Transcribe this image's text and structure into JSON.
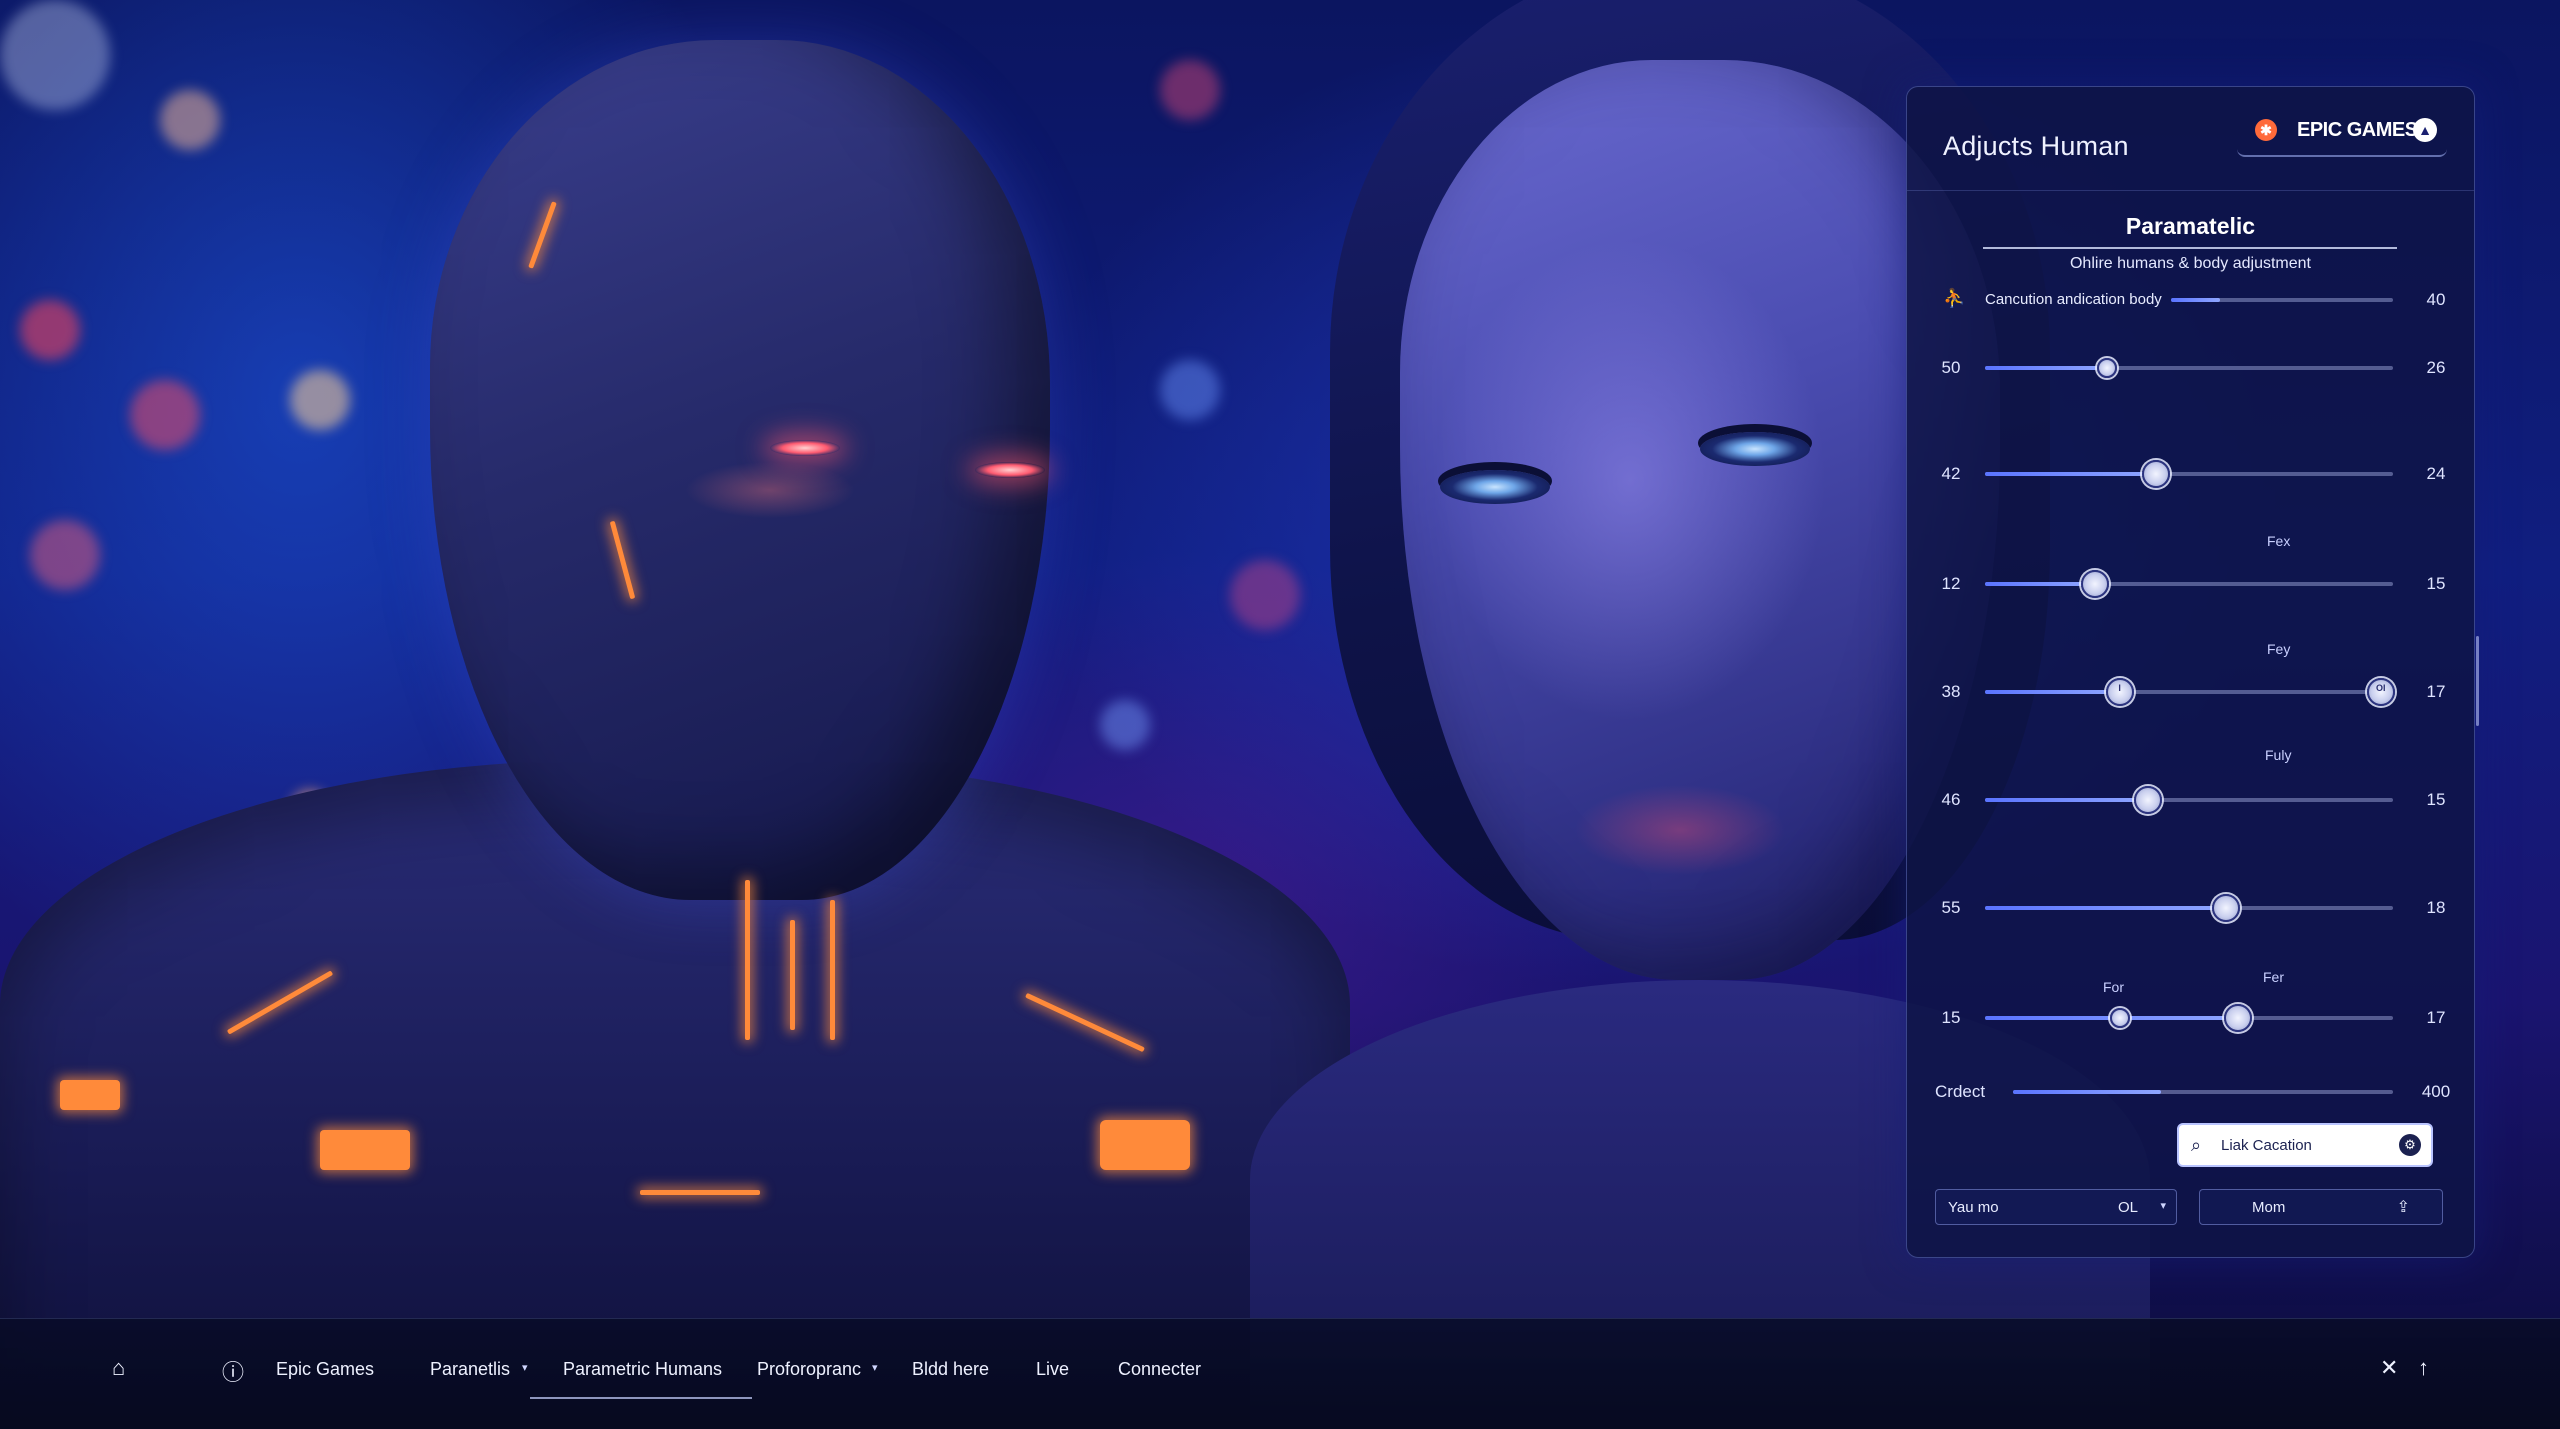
{
  "panel": {
    "title": "Adjucts Human",
    "brand": {
      "name": "EPIC GAMES",
      "mark_icon": "epic-logo-icon",
      "badge_icon": "user-badge-icon"
    },
    "section_title": "Paramatelic",
    "section_subtitle": "Ohlire humans & body adjustment",
    "first_row": {
      "icon": "figure-icon",
      "label": "Cancution andication body",
      "right": "40",
      "level": 0.22
    },
    "sliders": [
      {
        "left": "50",
        "right": "26",
        "caption": "",
        "level": 0.3
      },
      {
        "left": "42",
        "right": "24",
        "caption": "",
        "level": 0.42
      },
      {
        "left": "12",
        "right": "15",
        "caption": "Fex",
        "level": 0.27
      },
      {
        "left": "38",
        "right": "17",
        "caption": "Fey",
        "level": 0.33,
        "thumb_label": "I",
        "end_thumb_label": "OI"
      },
      {
        "left": "46",
        "right": "15",
        "caption": "Fuly",
        "level": 0.4
      },
      {
        "left": "55",
        "right": "18",
        "caption": "",
        "level": 0.59
      },
      {
        "left": "15",
        "right": "17",
        "caption_a": "For",
        "caption_b": "Fer",
        "level": 0.33,
        "level2": 0.62
      }
    ],
    "credit_row": {
      "label": "Crdect",
      "right": "400",
      "level": 0.39
    },
    "search": {
      "value": "Liak Caсation",
      "icon": "search-icon",
      "action_icon": "settings-dial-icon"
    },
    "select": {
      "label": "Yau mo",
      "value": "OL",
      "chevron": "▾"
    },
    "button": {
      "label": "Mom",
      "icon": "upload-icon"
    }
  },
  "taskbar": {
    "home_icon": "home-icon",
    "info_icon": "info-icon",
    "items": [
      "Epic Games",
      "Paranetlis",
      "Parametric Humans",
      "Proforopranc",
      "Bldd here",
      "Live",
      "Connecter"
    ],
    "active_index": 2,
    "close_icon": "close-icon",
    "up_icon": "arrow-up-icon"
  },
  "colors": {
    "accent": "#6a82ff",
    "panel_bg": "#0e1446",
    "glow_orange": "#ff8a3a"
  }
}
